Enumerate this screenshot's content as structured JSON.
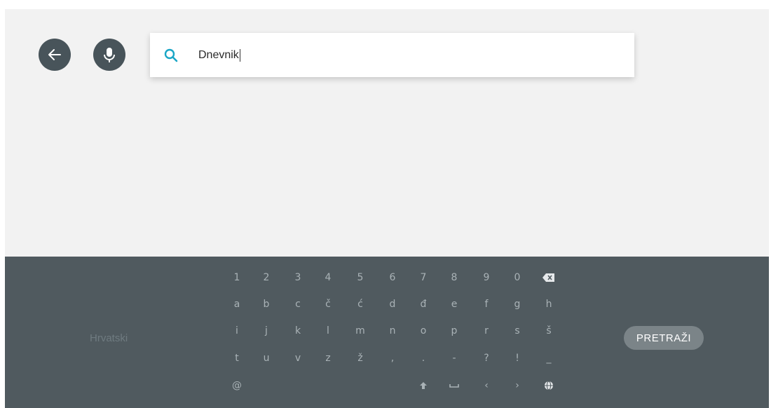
{
  "search": {
    "value": "Dnevnik"
  },
  "keyboard": {
    "language": "Hrvatski",
    "search_label": "PRETRAŽI",
    "rows": [
      [
        "1",
        "2",
        "3",
        "4",
        "5",
        "6",
        "7",
        "8",
        "9",
        "0",
        "⌫"
      ],
      [
        "a",
        "b",
        "c",
        "č",
        "ć",
        "d",
        "đ",
        "e",
        "f",
        "g",
        "h"
      ],
      [
        "i",
        "j",
        "k",
        "l",
        "m",
        "n",
        "o",
        "p",
        "r",
        "s",
        "š"
      ],
      [
        "t",
        "u",
        "v",
        "z",
        "ž",
        ",",
        ".",
        "-",
        "?",
        "!",
        "_"
      ],
      [
        "@",
        "",
        "",
        "",
        "",
        "",
        "⇧",
        "␣",
        "‹",
        "›",
        "◎"
      ]
    ]
  },
  "icons": {
    "back": "arrow-left-icon",
    "mic": "microphone-icon",
    "search": "search-icon",
    "backspace": "backspace-icon",
    "shift": "shift-icon",
    "space": "space-icon",
    "globe": "globe-icon"
  },
  "colors": {
    "accent": "#1aa6c6",
    "keyboard_bg": "#505a5f",
    "button_bg": "#48545a"
  }
}
